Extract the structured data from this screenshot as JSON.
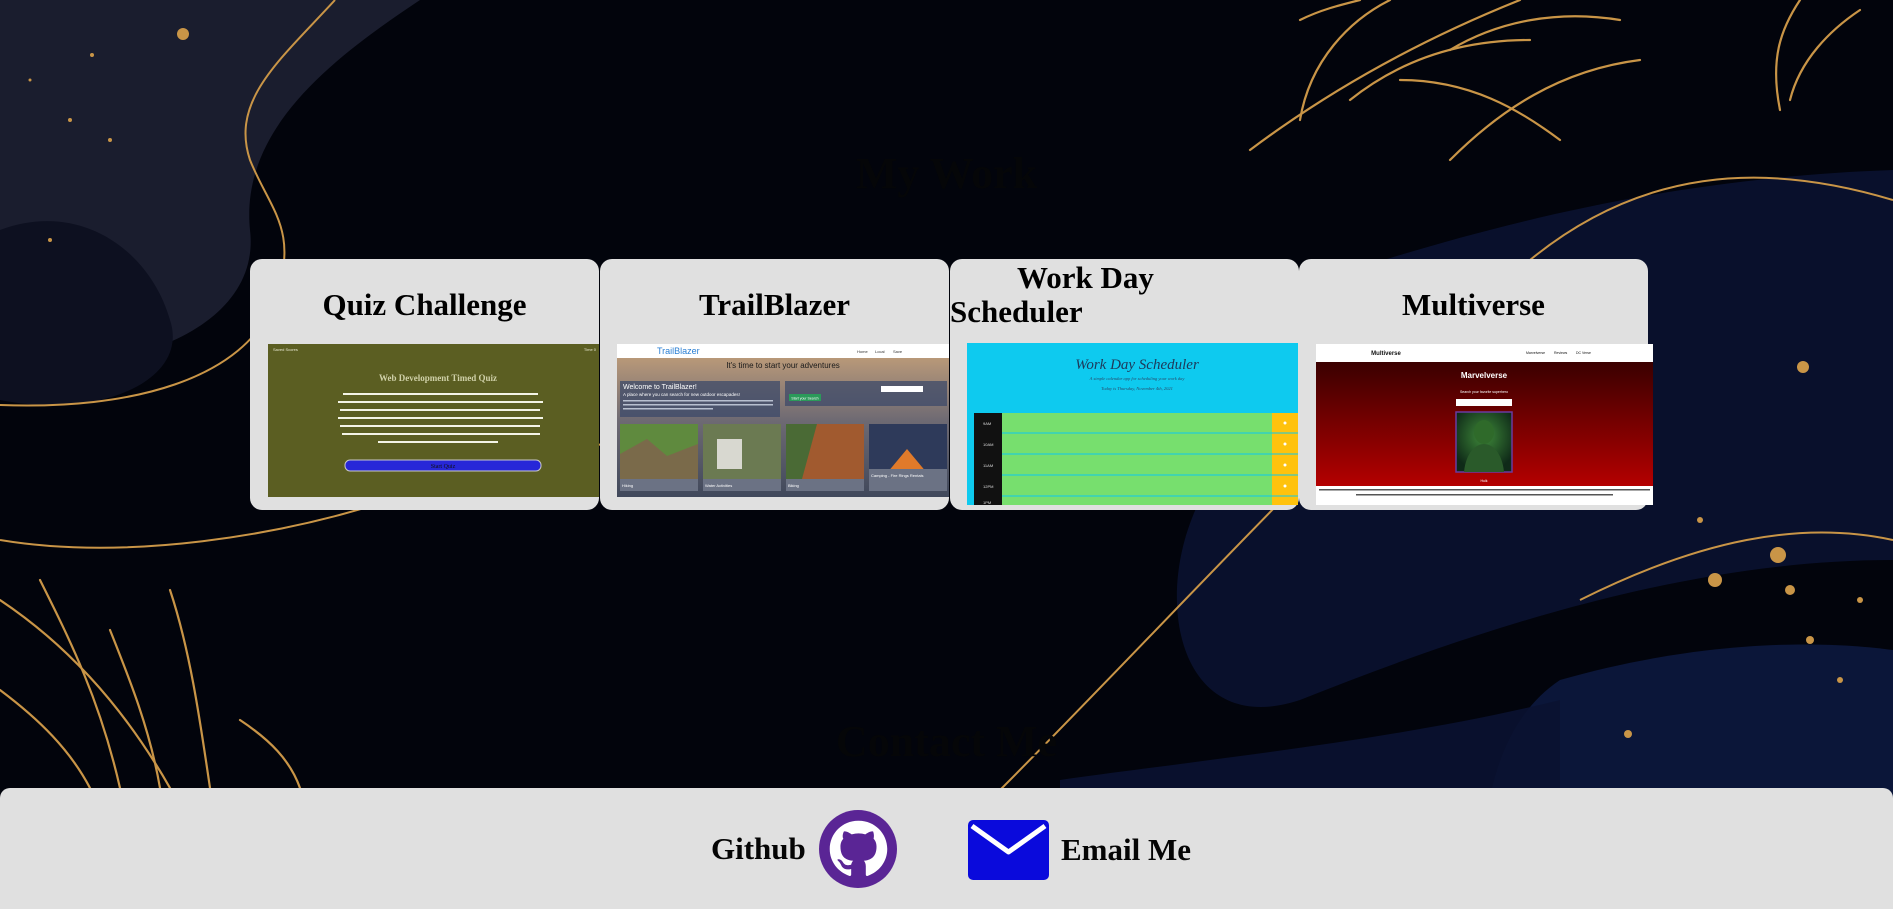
{
  "sections": {
    "work_heading": "My Work",
    "contact_heading": "Contact Me"
  },
  "projects": [
    {
      "title": "Quiz Challenge",
      "screenshot": {
        "topbar_left": "Saved Scores",
        "topbar_right": "Time 0",
        "heading": "Web Development Timed Quiz",
        "body": "Click on the button below to start a web-development-related quiz. You will be prompted to sequentially answer five multiple-choice questions within the allotted time displayed on the right-most corner. If the chosen answer is correct, a point will be added to your score. If you answer incorrectly, no extra points will be added PLUS you will LOSE ten seconds from the remaining time. The quiz ends either when you answer all ten questions or when the timer reaches 0.",
        "button": "Start Quiz",
        "bg_color": "#5b5e22"
      }
    },
    {
      "title": "TrailBlazer",
      "screenshot": {
        "brand": "TrailBlazer",
        "nav": [
          "Home",
          "Local",
          "Save"
        ],
        "banner": "It's time to start your adventures",
        "welcome": "Welcome to TrailBlazer!",
        "tagline": "A place where you can search for new outdoor escapades!",
        "go_button": "Start your Search",
        "activities": [
          "Hiking",
          "Water Activities",
          "Biking",
          "Camping - Fire Rings Rentals"
        ]
      }
    },
    {
      "title": "Work Day Scheduler",
      "screenshot": {
        "heading": "Work Day Scheduler",
        "subheading": "A simple calendar app for scheduling your work day",
        "date_line": "Today is Thursday, November 4th, 2021",
        "hours": [
          "9AM",
          "10AM",
          "11AM",
          "12PM",
          "1PM"
        ],
        "bg_color": "#0ecaef",
        "row_color": "#77df6e",
        "save_color": "#ffc20d"
      }
    },
    {
      "title": "Multiverse",
      "screenshot": {
        "brand": "Multiverse",
        "nav": [
          "Marvelverse",
          "Reviews",
          "DC Verse"
        ],
        "heading": "Marvelverse",
        "prompt": "Search your favorite superhero",
        "character": "Hulk",
        "caption": "Caught in a gamma bomb explosion while trying to save the life of a teenager, Dr. Bruce Banner was transformed into the incredibly powerful creature called the Hulk. An all too often misunderstood hero, the angrier the Hulk gets, the stronger the Hulk gets."
      }
    }
  ],
  "contact": {
    "github_label": "Github",
    "email_label": "Email Me",
    "github_icon": "github-icon",
    "email_icon": "envelope-icon",
    "github_color": "#5a2595",
    "email_color": "#0a0adc"
  },
  "theme": {
    "background": "#02040c",
    "gold": "#c99547",
    "card_bg": "#e0e0e0"
  }
}
